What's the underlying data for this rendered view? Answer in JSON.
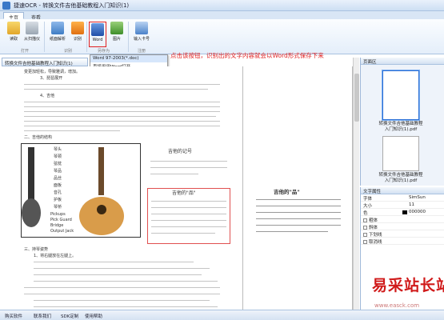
{
  "window": {
    "title": "捷速OCR - 转换文件吉他基础教程入门知识(1)"
  },
  "tabs": [
    {
      "label": "主页"
    },
    {
      "label": "查看"
    }
  ],
  "ribbon": {
    "buttons": [
      {
        "label": "读取",
        "icon": "folder-open-icon"
      },
      {
        "label": "从扫描仪",
        "icon": "scanner-icon"
      },
      {
        "label": "纸面解析",
        "icon": "page-analyze-icon"
      },
      {
        "label": "识别",
        "icon": "ocr-icon"
      },
      {
        "label": "Word",
        "icon": "word-icon"
      },
      {
        "label": "图片",
        "icon": "image-icon"
      },
      {
        "label": "输入卡号",
        "icon": "key-card-icon"
      }
    ],
    "groups": [
      {
        "label": "打开"
      },
      {
        "label": "识别"
      },
      {
        "label": "另存为"
      },
      {
        "label": "注册"
      }
    ]
  },
  "dropdown": {
    "items": [
      "Word 97-2003(*.doc)",
      "直接用用Word打开"
    ]
  },
  "annotation": "点击该按钮，识别出的文字内容就会以Word形式保存下来",
  "document": {
    "tab_label": "转换文件吉他基础教程入门知识(1)",
    "left_lines": [
      "变更加轻松，导致雅调，增加。",
      "3、琵琶展开",
      "4、吉他",
      "二、吉他的结构",
      "三、持琴姿势",
      "1、将右腿放在左腿上。"
    ],
    "guitar_labels": [
      "琴头",
      "琴颈",
      "弦枕",
      "琴品",
      "品丝",
      "面板",
      "音孔",
      "护板",
      "琴桥",
      "Pickups",
      "Pick Guard",
      "Bridge",
      "Output Jack"
    ],
    "section_title": "吉他的记号",
    "box_title": "吉他的\"品\"",
    "right_title": "吉他的\"品\""
  },
  "page_panel": {
    "title": "页面区",
    "thumbs": [
      {
        "label": "转换文件吉他基础教程入门知识(1).pdf"
      },
      {
        "label": "转换文件吉他基础教程入门知识(1).pdf"
      }
    ]
  },
  "props_panel": {
    "title": "文字属性",
    "rows": [
      {
        "key": "字体",
        "value": "SimSun"
      },
      {
        "key": "大小",
        "value": "11"
      },
      {
        "key": "色",
        "value": "000000"
      },
      {
        "key": "粗体",
        "value": ""
      },
      {
        "key": "斜体",
        "value": ""
      },
      {
        "key": "下划线",
        "value": ""
      },
      {
        "key": "取消线",
        "value": ""
      }
    ]
  },
  "status": {
    "items": [
      "购买软件",
      "联系我们",
      "SDK定制",
      "使用帮助"
    ]
  },
  "watermark": {
    "text": "易采站长站",
    "url": "www.easck.com"
  }
}
